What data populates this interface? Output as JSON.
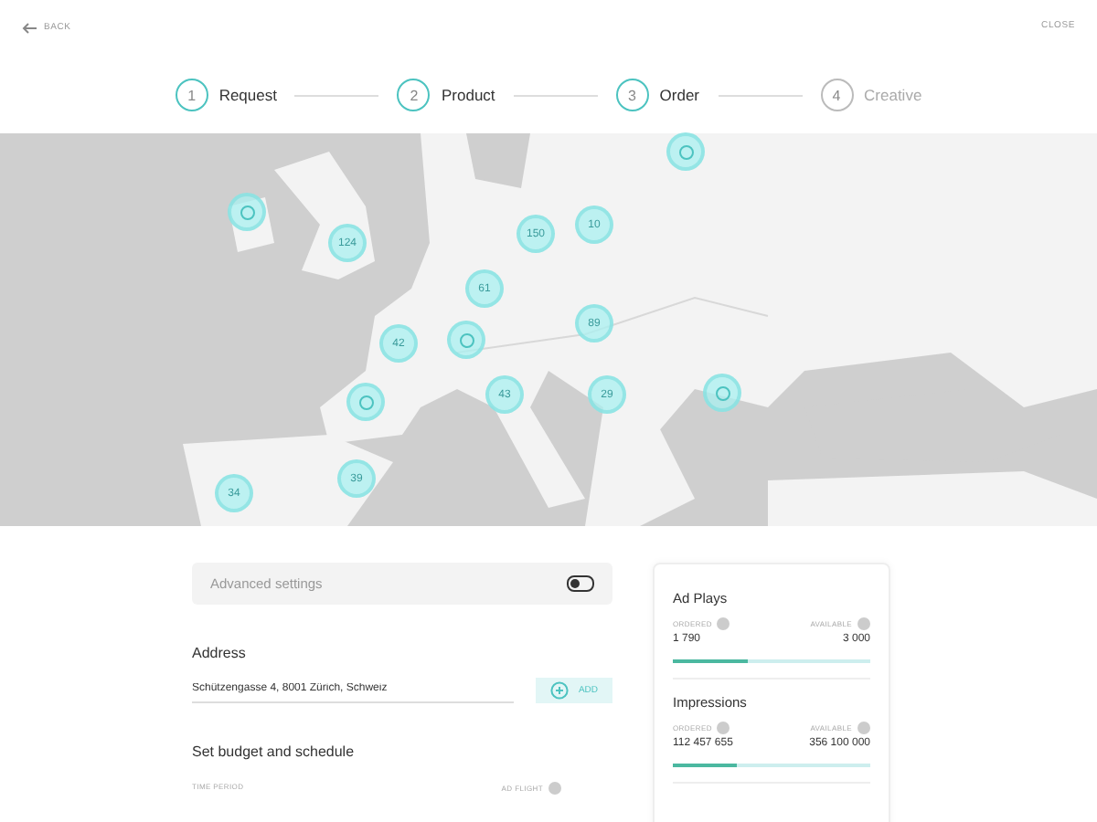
{
  "header": {
    "back": "BACK",
    "close": "CLOSE"
  },
  "steps": [
    {
      "number": "1",
      "label": "Request",
      "completed": true
    },
    {
      "number": "2",
      "label": "Product",
      "completed": true
    },
    {
      "number": "3",
      "label": "Order",
      "completed": true
    },
    {
      "number": "4",
      "label": "Creative",
      "completed": false
    }
  ],
  "map": {
    "markers": [
      {
        "kind": "single"
      },
      {
        "kind": "single"
      },
      {
        "kind": "cluster",
        "label": "124"
      },
      {
        "kind": "cluster",
        "label": "150"
      },
      {
        "kind": "cluster",
        "label": "10"
      },
      {
        "kind": "cluster",
        "label": "61"
      },
      {
        "kind": "cluster",
        "label": "42"
      },
      {
        "kind": "single"
      },
      {
        "kind": "cluster",
        "label": "89"
      },
      {
        "kind": "cluster",
        "label": "43"
      },
      {
        "kind": "single"
      },
      {
        "kind": "cluster",
        "label": "29"
      },
      {
        "kind": "single"
      },
      {
        "kind": "cluster",
        "label": "39"
      },
      {
        "kind": "cluster",
        "label": "34"
      }
    ]
  },
  "advanced": {
    "label": "Advanced settings",
    "on": false
  },
  "address": {
    "heading": "Address",
    "value": "Schützengasse 4, 8001 Zürich, Schweiz",
    "button": "ADD"
  },
  "budget": {
    "heading": "Set budget and schedule",
    "column_1": "TIME PERIOD",
    "column_2": "AD FLIGHT"
  },
  "metrics": [
    {
      "title": "Ad Plays",
      "ordered_label": "ORDERED",
      "available_label": "AVAILABLE",
      "ordered": "1 790",
      "available": "3 000",
      "level": 0.38
    },
    {
      "title": "Impressions",
      "ordered_label": "ORDERED",
      "available_label": "AVAILABLE",
      "ordered": "112 457 655",
      "available": "356 100 000",
      "level": 0.32
    }
  ]
}
